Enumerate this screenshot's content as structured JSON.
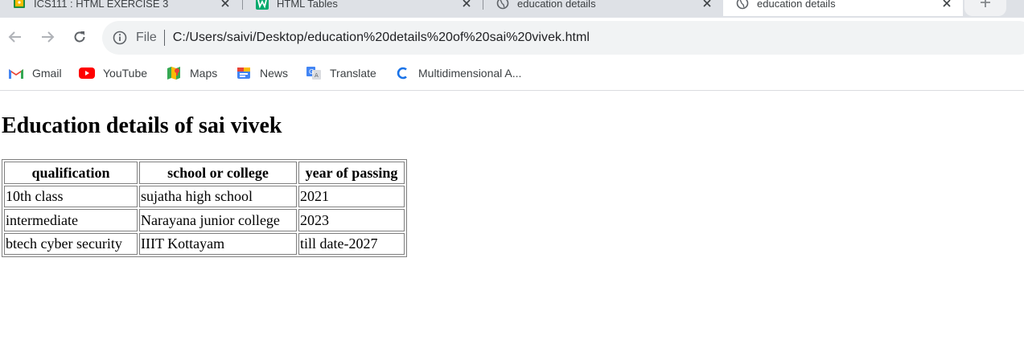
{
  "browser": {
    "tabs": [
      {
        "title": "ICS111 : HTML EXERCISE 3",
        "favicon": "classroom-favicon-icon"
      },
      {
        "title": "HTML Tables",
        "favicon": "w3schools-favicon-icon"
      },
      {
        "title": "education details",
        "favicon": "globe-favicon-icon"
      },
      {
        "title": "education details",
        "favicon": "globe-favicon-icon",
        "active": true
      }
    ],
    "address": {
      "scheme_label": "File",
      "url": "C:/Users/saivi/Desktop/education%20details%20of%20sai%20vivek.html"
    },
    "bookmarks": [
      {
        "label": "Gmail",
        "icon": "gmail-icon"
      },
      {
        "label": "YouTube",
        "icon": "youtube-icon"
      },
      {
        "label": "Maps",
        "icon": "maps-icon"
      },
      {
        "label": "News",
        "icon": "news-icon"
      },
      {
        "label": "Translate",
        "icon": "translate-icon"
      },
      {
        "label": "Multidimensional A...",
        "icon": "c-logo-icon"
      }
    ]
  },
  "page": {
    "heading": "Education details of sai vivek",
    "table": {
      "headers": [
        "qualification",
        "school or college",
        "year of passing"
      ],
      "rows": [
        [
          "10th class",
          "sujatha high school",
          "2021"
        ],
        [
          "intermediate",
          "Narayana junior college",
          "2023"
        ],
        [
          "btech cyber security",
          "IIIT Kottayam",
          "till date-2027"
        ]
      ]
    }
  },
  "colors": {
    "tabstrip": "#dee1e6",
    "omnibox": "#f1f3f4",
    "youtube_red": "#ff0000",
    "gmail_red": "#ea4335"
  }
}
